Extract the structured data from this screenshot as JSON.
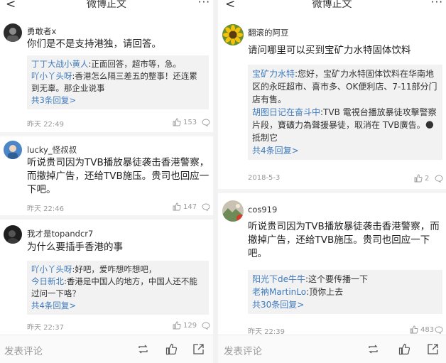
{
  "header_title": "微博正文",
  "back_glyph": "<",
  "more_glyph": "···",
  "reply_more_suffix": ">",
  "left": {
    "comments": [
      {
        "avatar_icon": "user-avatar-icon",
        "username": "勇敢者x",
        "text": "你们是不是支持港独，请回答。",
        "replies": [
          {
            "name": "丁丁大战小黄人",
            "text": ":正面回答，超市等，急。"
          },
          {
            "name": "吖小丫头呀",
            "text": ":香港怎么隔三差五的整事！还连累到无辜。那企业说事"
          }
        ],
        "more_replies": "共3条回复",
        "time": "昨天 22:49",
        "likes": "153"
      },
      {
        "avatar_icon": "user-avatar-icon",
        "username": "lucky_怪叔叔",
        "text": "听说贵司因为TVB播放暴徒袭击香港警察，而撤掉广告，还给TVB施压。贵司也回应一下吧。",
        "time": "昨天 22:46",
        "likes": "147"
      },
      {
        "avatar_icon": "user-avatar-icon",
        "username": "我才是topandcr7",
        "text": "为什么要插手香港的事",
        "replies": [
          {
            "name": "吖小丫头呀",
            "text": ":好吧，爱咋想咋想吧，"
          },
          {
            "name": "今日新北",
            "text": ":香港是中国人的地方，中国人还不能过问一下咯？"
          }
        ],
        "more_replies": "共4条回复",
        "time": "昨天 22:37",
        "likes": "129"
      }
    ],
    "comment_placeholder": "发表评论"
  },
  "right": {
    "comments": [
      {
        "avatar_icon": "sunflower-avatar-icon",
        "username": "翻滚的阿豆",
        "text": "请问哪里可以买到宝矿力水特固体饮料",
        "replies": [
          {
            "name": "宝矿力水特",
            "text": ":您好，宝矿力水特固体饮料在华南地区的永旺超市、喜市多、OK便利店、7-11部分门店有售。"
          },
          {
            "name": "胡图日记在奋斗中",
            "text": ":TVB 電視台播放暴徒攻擊警察片段，寶礦力為聲援暴徒，取消在 TVB廣告。🌑 抵制它"
          }
        ],
        "more_replies": "共4条回复",
        "time": "2018-5-3",
        "likes": "2"
      },
      {
        "avatar_icon": "user-avatar-icon",
        "username": "cos919",
        "text": "听说贵司因为TVB播放暴徒袭击香港警察，而撤掉广告，还给TVB施压。贵司也回应一下吧。",
        "replies": [
          {
            "name": "阳光下de牛牛",
            "text": ":这个要传播一下"
          },
          {
            "name": "老衲MartinLo",
            "text": ":顶你上去"
          }
        ],
        "more_replies": "共30条回复",
        "time": "昨天 22:39",
        "likes": "483"
      }
    ],
    "comment_placeholder": "发表评论"
  },
  "icons": [
    "back-arrow-icon",
    "more-icon",
    "like-icon",
    "comment-icon",
    "repost-icon",
    "share-icon"
  ],
  "colors": {
    "link": "#3f7bbd",
    "reply_bg": "#f2f2f2",
    "muted": "#999999"
  }
}
